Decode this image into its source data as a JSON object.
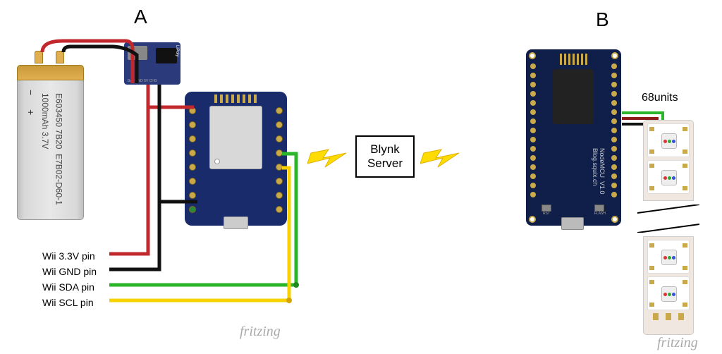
{
  "panels": {
    "a": "A",
    "b": "B"
  },
  "battery": {
    "polarity": "− +",
    "line1": "E603450 7B20",
    "line2": "E7B02-D60-1",
    "line3": "1000mAh 3.7V"
  },
  "charger": {
    "label": "LiPoly",
    "pins_text": "BAT  GND  5V  CHG"
  },
  "blynk": {
    "line1": "Blynk",
    "line2": "Server"
  },
  "nodemcu": {
    "name": "NodeMCU",
    "version": "V1.0",
    "domain": "Blog.squix.ch",
    "btn_rst": "RST",
    "btn_flash": "FLASH"
  },
  "led": {
    "units": "68units"
  },
  "legend": {
    "p33": "Wii 3.3V pin",
    "gnd": "Wii GND pin",
    "sda": "Wii SDA pin",
    "scl": "Wii SCL pin"
  },
  "watermark": "fritzing",
  "wires_a": [
    {
      "name": "3v3",
      "color": "#c1272d"
    },
    {
      "name": "gnd",
      "color": "#111111"
    },
    {
      "name": "sda",
      "color": "#2ab52a"
    },
    {
      "name": "scl",
      "color": "#f7d100"
    }
  ],
  "wires_b": [
    {
      "name": "vcc",
      "color": "#8b1a1a"
    },
    {
      "name": "gnd",
      "color": "#111111"
    },
    {
      "name": "data",
      "color": "#2ab52a"
    }
  ]
}
